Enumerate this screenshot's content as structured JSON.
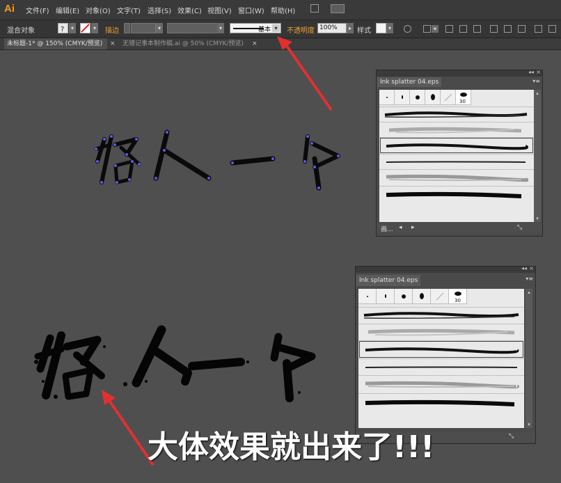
{
  "app": {
    "logo": "Ai"
  },
  "menu": [
    {
      "label": "文件(F)"
    },
    {
      "label": "编辑(E)"
    },
    {
      "label": "对象(O)"
    },
    {
      "label": "文字(T)"
    },
    {
      "label": "选择(S)"
    },
    {
      "label": "效果(C)"
    },
    {
      "label": "视图(V)"
    },
    {
      "label": "窗口(W)"
    },
    {
      "label": "帮助(H)"
    }
  ],
  "control": {
    "selection_label": "混合对象",
    "stroke_label": "描边",
    "stroke_style": "基本",
    "opacity_label": "不透明度",
    "opacity_value": "100%",
    "style_label": "样式"
  },
  "tabs": [
    {
      "label": "未标题-1* @ 150% (CMYK/预览)"
    },
    {
      "label": "无错记事本制作稿.ai @ 50% (CMYK/预览)"
    }
  ],
  "tab_close": "×",
  "panels": [
    {
      "name": "Ink splatter 04.eps",
      "tip_number": "30",
      "footer_label": "画..."
    },
    {
      "name": "Ink splatter 04.eps",
      "tip_number": "30"
    }
  ],
  "caption": "大体效果就出来了!!!",
  "colors": {
    "accent_orange": "#f0a030",
    "arrow_red": "#e23030",
    "anchor_blue": "#5a5af0",
    "canvas": "#4f4f4f"
  },
  "icons": [
    "swatch-icon",
    "stroke-none-icon",
    "recolor-icon",
    "align-icon",
    "distribute-icon",
    "close-icon",
    "panel-menu-icon",
    "new-brush-icon",
    "delete-brush-icon"
  ]
}
